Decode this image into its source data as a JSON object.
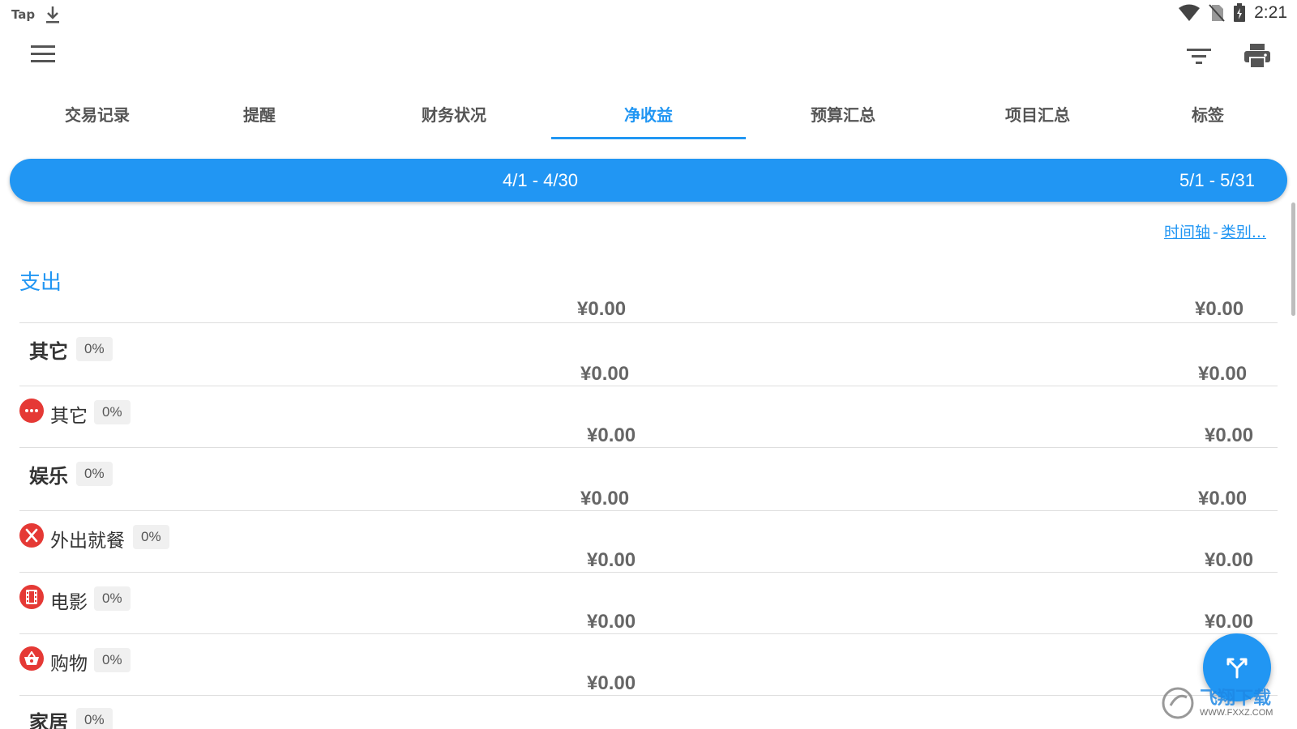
{
  "status_bar": {
    "app_label": "Tap",
    "time": "2:21"
  },
  "toolbar": {
    "menu_icon": "hamburger-menu-icon",
    "filter_icon": "filter-icon",
    "print_icon": "print-icon"
  },
  "tabs": [
    {
      "label": "交易记录",
      "active": false
    },
    {
      "label": "提醒",
      "active": false
    },
    {
      "label": "财务状况",
      "active": false
    },
    {
      "label": "净收益",
      "active": true
    },
    {
      "label": "预算汇总",
      "active": false
    },
    {
      "label": "项目汇总",
      "active": false
    },
    {
      "label": "标签",
      "active": false
    }
  ],
  "periods": {
    "current": "4/1 - 4/30",
    "next": "5/1 - 5/31"
  },
  "view_links": {
    "timeline": "时间轴",
    "separator": "-",
    "category": "类别..."
  },
  "section": {
    "title": "支出",
    "total_current": "¥0.00",
    "total_next": "¥0.00"
  },
  "rows": [
    {
      "name": "其它",
      "pct": "0%",
      "type": "category",
      "current": "¥0.00",
      "next": "¥0.00"
    },
    {
      "name": "其它",
      "pct": "0%",
      "type": "sub",
      "icon": "more-dots-icon",
      "current": "¥0.00",
      "next": "¥0.00"
    },
    {
      "name": "娱乐",
      "pct": "0%",
      "type": "category",
      "current": "¥0.00",
      "next": "¥0.00"
    },
    {
      "name": "外出就餐",
      "pct": "0%",
      "type": "sub",
      "icon": "cutlery-icon",
      "current": "¥0.00",
      "next": "¥0.00"
    },
    {
      "name": "电影",
      "pct": "0%",
      "type": "sub",
      "icon": "film-icon",
      "current": "¥0.00",
      "next": "¥0.00"
    },
    {
      "name": "购物",
      "pct": "0%",
      "type": "sub",
      "icon": "shopping-basket-icon",
      "current": "¥0.00",
      "next": ""
    },
    {
      "name": "家居",
      "pct": "0%",
      "type": "category",
      "current": "",
      "next": ""
    }
  ],
  "fab": {
    "icon": "split-arrows-icon"
  },
  "watermark": {
    "brand": "飞翔下载",
    "url": "WWW.FXXZ.COM"
  },
  "colors": {
    "primary": "#2196F3",
    "icon_red": "#E53935"
  }
}
